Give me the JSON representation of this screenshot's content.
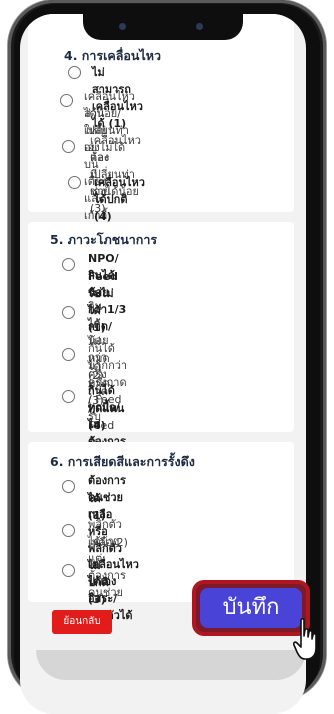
{
  "sections": [
    {
      "title": "4. การเคลื่อนไหว",
      "options": [
        {
          "lines": [
            "ไม่สามารถเคลื่อนไหวได้ (1)"
          ],
          "bold": true
        },
        {
          "lines": [
            "เคลื่อนไหวได้น้อย/เปลี่ยนท่าเองไม่ได้",
            "ส่วนใหญ่อยู่บนเตียงและเก้าอี้ (2)"
          ],
          "bold": false
        },
        {
          "lines": [
            "เคลื่อนไหวและเปลี่ยนท่าเองได้น้อย",
            "ต้องมีช่วย (3)"
          ],
          "bold": false
        },
        {
          "lines": [
            "เคลื่อนไหวได้ปกติ (4)"
          ],
          "bold": true
        }
      ]
    },
    {
      "title": "5. ภาวะโภชนาการ",
      "options": [
        {
          "lines": [
            "NPO/กินได้น้อยกว่า1/3 ถาด/",
            "Feed รับไม่ได้ (1)"
          ],
          "bold": true
        },
        {
          "lines": [
            "กินได้น้อยกว่าครึ่งถาด / Feed รับ",
            "ได้ไม่หมด (2)"
          ],
          "bold": false
        },
        {
          "lines": [
            "กินได้มากกว่าครึ่งถาด / Feed รับ",
            "ได้หมด (3)"
          ],
          "bold": false
        },
        {
          "lines": [
            "กินได้ทุกมื้อ/ไม่ต้องการอาหารเสริม",
            "ทดแทน (4)"
          ],
          "bold": true
        }
      ]
    },
    {
      "title": "6. การเสียดสีและการรั้งดึง",
      "options": [
        {
          "lines": [
            "ต้องการคนช่วยเหลือหรือพลิกตัวไม่",
            "ได้ (1)"
          ],
          "bold": true
        },
        {
          "lines": [
            "พลิกตัวได้บ้าง แต่ต้องการคนช่วย",
            "เหลือ(2)"
          ],
          "bold": false
        },
        {
          "lines": [
            "เคลื่อนไหวได้เองอิสระ/ทรงตัวได้",
            "ปกติ (3)"
          ],
          "bold": true
        }
      ]
    }
  ],
  "buttons": {
    "back": "ย้อนกลับ",
    "save": "บันทึก"
  },
  "icons": {
    "cursor": "hand-pointer-icon"
  },
  "colors": {
    "save_bg": "#4a43d8",
    "save_border": "#b01620",
    "back_bg": "#e21b1b"
  }
}
